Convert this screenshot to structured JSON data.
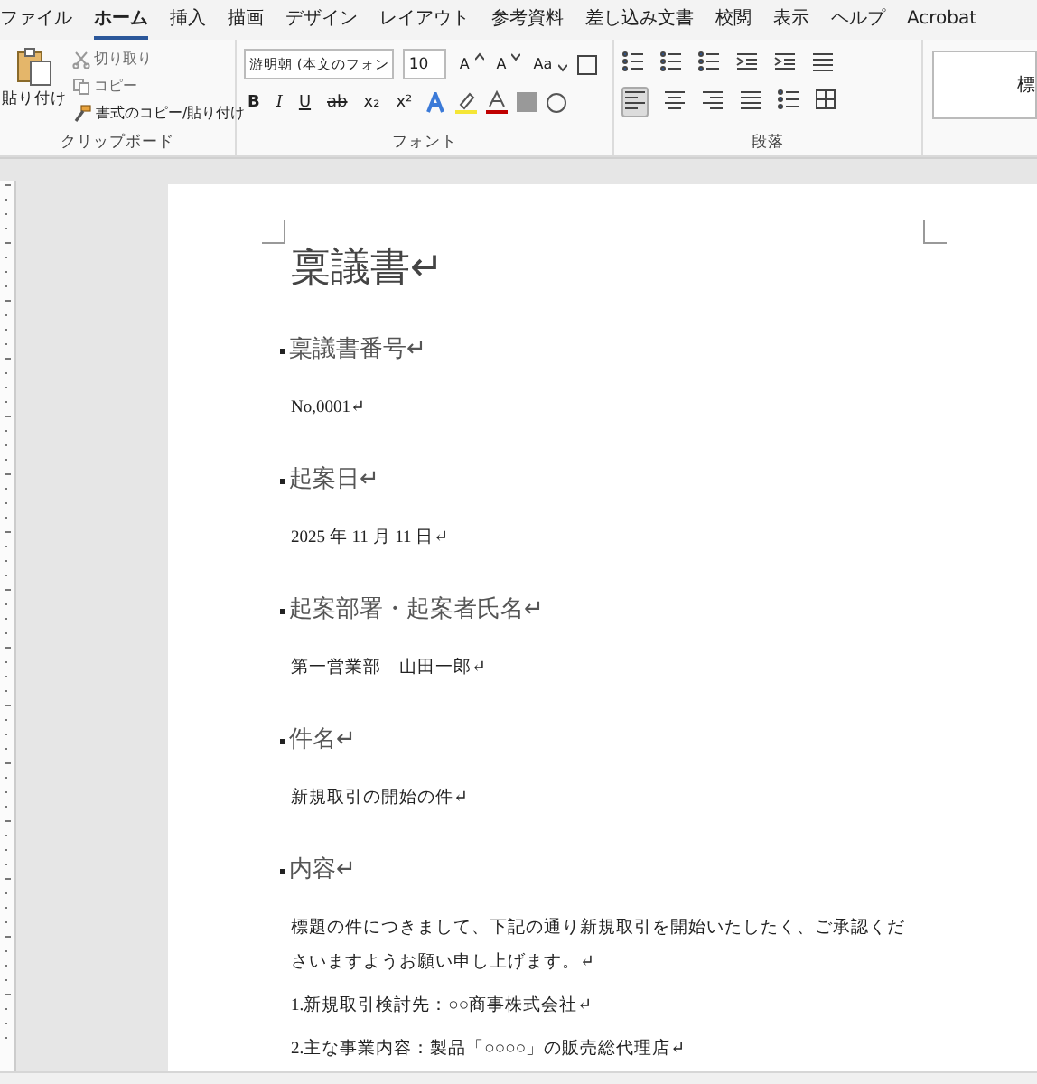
{
  "menu_tabs": [
    {
      "label": "ファイル",
      "selected": false
    },
    {
      "label": "ホーム",
      "selected": true
    },
    {
      "label": "挿入",
      "selected": false
    },
    {
      "label": "描画",
      "selected": false
    },
    {
      "label": "デザイン",
      "selected": false
    },
    {
      "label": "レイアウト",
      "selected": false
    },
    {
      "label": "参考資料",
      "selected": false
    },
    {
      "label": "差し込み文書",
      "selected": false
    },
    {
      "label": "校閲",
      "selected": false
    },
    {
      "label": "表示",
      "selected": false
    },
    {
      "label": "ヘルプ",
      "selected": false
    },
    {
      "label": "Acrobat",
      "selected": false
    }
  ],
  "clipboard": {
    "paste": "貼り付け",
    "actions": [
      {
        "kind": "cut",
        "label": "切り取り",
        "disabled": true
      },
      {
        "kind": "copy",
        "label": "コピー",
        "disabled": true
      },
      {
        "kind": "painter",
        "label": "書式のコピー/貼り付け",
        "disabled": false
      }
    ],
    "group_label": "クリップボード"
  },
  "font": {
    "font_name": "游明朝 (本文のフォン",
    "font_size": "10",
    "row1": [
      {
        "kind": "grow",
        "label": "A"
      },
      {
        "kind": "shrink",
        "label": "A"
      },
      {
        "kind": "case",
        "label": "Aa"
      }
    ],
    "row2": [
      {
        "kind": "bold",
        "label": "B"
      },
      {
        "kind": "italic",
        "label": "I"
      },
      {
        "kind": "underline",
        "label": "U"
      },
      {
        "kind": "strike",
        "label": "ab"
      },
      {
        "kind": "sub",
        "label": "x₂"
      },
      {
        "kind": "sup",
        "label": "x²"
      }
    ],
    "group_label": "フォント"
  },
  "paragraph": {
    "group_label": "段落",
    "align_left_selected": true
  },
  "styles": {
    "first": "標"
  },
  "document": {
    "title": "稟議書↵",
    "sections": [
      {
        "heading": "稟議書番号↵",
        "paragraphs": [
          "No,0001↵"
        ]
      },
      {
        "heading": "起案日↵",
        "paragraphs": [
          "2025 年 11 月 11 日↵"
        ]
      },
      {
        "heading": "起案部署・起案者氏名↵",
        "paragraphs": [
          "第一営業部　山田一郎↵"
        ]
      },
      {
        "heading": "件名↵",
        "paragraphs": [
          "新規取引の開始の件↵"
        ]
      },
      {
        "heading": "内容↵",
        "paragraphs": [
          "標題の件につきまして、下記の通り新規取引を開始いたしたく、ご承認くださいますようお願い申し上げます。↵",
          "1.新規取引検討先：○○商事株式会社↵",
          "2.主な事業内容：製品「○○○○」の販売総代理店↵"
        ]
      }
    ]
  }
}
